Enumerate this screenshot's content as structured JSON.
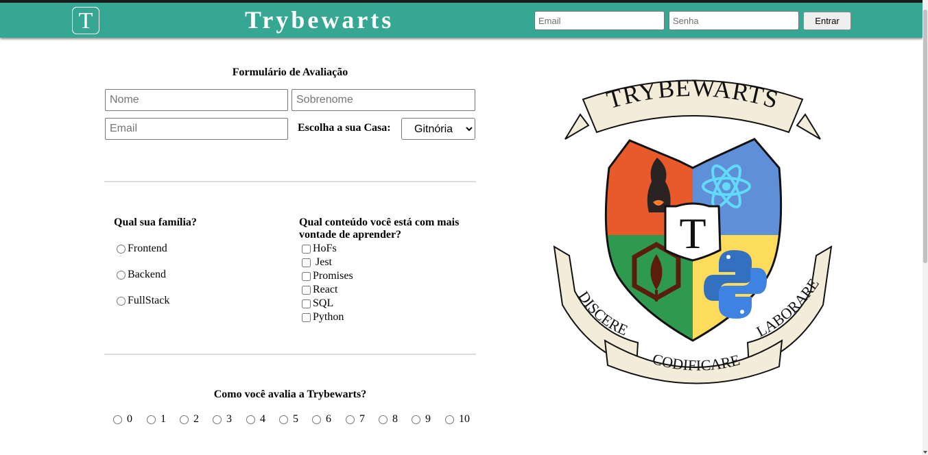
{
  "header": {
    "logo_letter": "T",
    "title": "Trybewarts",
    "email_placeholder": "Email",
    "password_placeholder": "Senha",
    "login_button": "Entrar"
  },
  "form": {
    "title": "Formulário de Avaliação",
    "first_name_placeholder": "Nome",
    "last_name_placeholder": "Sobrenome",
    "email_placeholder": "Email",
    "house_label": "Escolha a sua Casa:",
    "house_selected": "Gitnória",
    "family_question": "Qual sua família?",
    "family_options": [
      "Frontend",
      "Backend",
      "FullStack"
    ],
    "content_question": "Qual conteúdo você está com mais vontade de aprender?",
    "content_options": [
      "HoFs",
      "Jest",
      "Promises",
      "React",
      "SQL",
      "Python"
    ],
    "rating_question": "Como você avalia a Trybewarts?",
    "rating_options": [
      "0",
      "1",
      "2",
      "3",
      "4",
      "5",
      "6",
      "7",
      "8",
      "9",
      "10"
    ]
  },
  "crest": {
    "banner_top": "TRYBEWARTS",
    "center_letter": "T",
    "motto_left": "DISCERE",
    "motto_bottom": "CODIFICARE",
    "motto_right": "LABORARE",
    "colors": {
      "red": "#e85a2a",
      "blue": "#5f8fd6",
      "green": "#2e9a4f",
      "yellow": "#fddc5c",
      "banner": "#f3ecd9",
      "header": "#36a792"
    }
  }
}
